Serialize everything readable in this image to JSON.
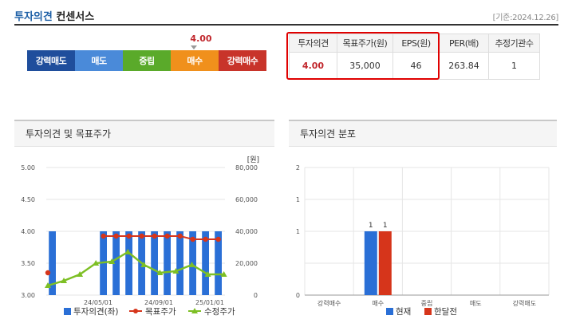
{
  "header": {
    "title_main": "투자의견",
    "title_sub": " 컨센서스",
    "date": "[기준:2024.12.26]"
  },
  "consensus": {
    "score": "4.00",
    "segments": [
      {
        "label": "강력매도",
        "color": "#1f4e9c"
      },
      {
        "label": "매도",
        "color": "#4a8ad9"
      },
      {
        "label": "중립",
        "color": "#5aaa2a"
      },
      {
        "label": "매수",
        "color": "#f0901c"
      },
      {
        "label": "강력매수",
        "color": "#c8342a"
      }
    ]
  },
  "summary": {
    "headers": [
      "투자의견",
      "목표주가(원)",
      "EPS(원)",
      "PER(배)",
      "추정기관수"
    ],
    "values": [
      "4.00",
      "35,000",
      "46",
      "263.84",
      "1"
    ]
  },
  "panels": {
    "left_title": "투자의견 및 목표주가",
    "right_title": "투자의견 분포"
  },
  "chart_data": [
    {
      "type": "bar",
      "title": "투자의견 및 목표주가",
      "y_left_ticks": [
        "5.00",
        "4.50",
        "4.00",
        "3.50",
        "3.00"
      ],
      "y_right_ticks": [
        "80,000",
        "60,000",
        "40,000",
        "20,000",
        "0"
      ],
      "y_right_unit": "[원]",
      "ylim_left": [
        3.0,
        5.0
      ],
      "ylim_right": [
        0,
        80000
      ],
      "x_ticks": [
        "24/05/01",
        "24/09/01",
        "25/01/01"
      ],
      "series": [
        {
          "name": "투자의견(좌)",
          "type": "bar",
          "color": "#2a6fd6",
          "values": [
            4.0,
            0,
            0,
            0,
            4.0,
            4.0,
            4.0,
            4.0,
            4.0,
            4.0,
            4.0,
            4.0,
            4.0,
            4.0
          ]
        },
        {
          "name": "목표주가",
          "type": "line",
          "color": "#d6351b",
          "values": [
            null,
            null,
            null,
            null,
            37000,
            37000,
            37000,
            37000,
            37000,
            37000,
            37000,
            35000,
            35000,
            35000
          ]
        },
        {
          "name": "수정주가",
          "type": "line",
          "color": "#7dbf24",
          "values": [
            6000,
            9000,
            13000,
            20000,
            21000,
            27000,
            19000,
            14000,
            15000,
            19000,
            13000,
            13000
          ]
        }
      ]
    },
    {
      "type": "bar",
      "title": "투자의견 분포",
      "categories": [
        "강력매수",
        "매수",
        "중립",
        "매도",
        "강력매도"
      ],
      "y_ticks": [
        "2",
        "1",
        "1",
        "0"
      ],
      "ylim": [
        0,
        2
      ],
      "series": [
        {
          "name": "현재",
          "color": "#2a6fd6",
          "values": [
            0,
            1,
            0,
            0,
            0
          ]
        },
        {
          "name": "한달전",
          "color": "#d6351b",
          "values": [
            0,
            1,
            0,
            0,
            0
          ]
        }
      ],
      "data_labels": [
        "1",
        "1"
      ]
    }
  ]
}
